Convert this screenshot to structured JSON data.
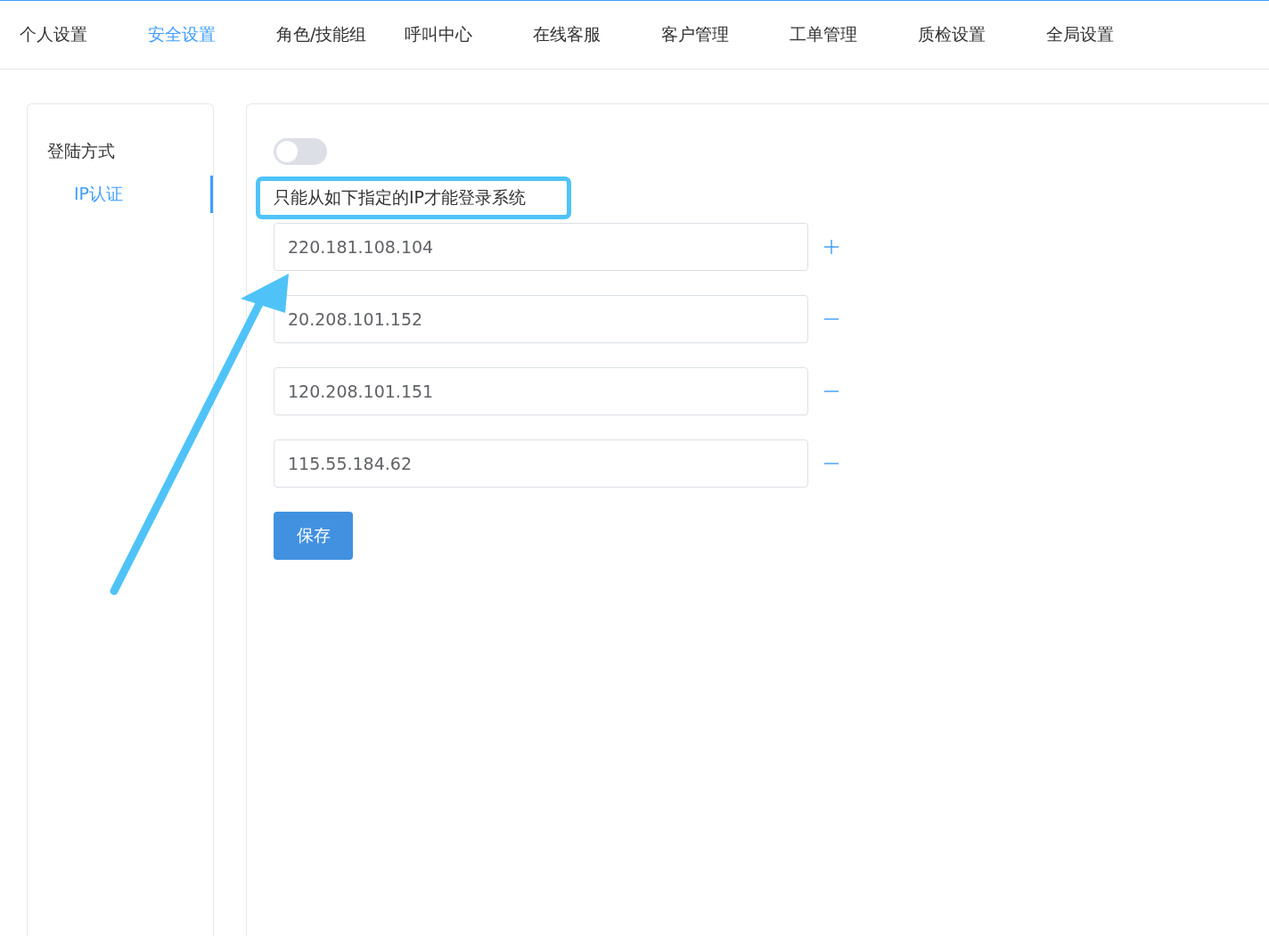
{
  "tabs": [
    {
      "label": "个人设置",
      "selected": false
    },
    {
      "label": "安全设置",
      "selected": true
    },
    {
      "label": "角色/技能组",
      "selected": false
    },
    {
      "label": "呼叫中心",
      "selected": false
    },
    {
      "label": "在线客服",
      "selected": false
    },
    {
      "label": "客户管理",
      "selected": false
    },
    {
      "label": "工单管理",
      "selected": false
    },
    {
      "label": "质检设置",
      "selected": false
    },
    {
      "label": "全局设置",
      "selected": false
    }
  ],
  "sidebar": {
    "heading": "登陆方式",
    "items": [
      {
        "label": "IP认证",
        "selected": true
      }
    ]
  },
  "ip_auth": {
    "toggle": {
      "on": false
    },
    "description": "只能从如下指定的IP才能登录系统",
    "ips": [
      {
        "value": "220.181.108.104",
        "kind": "add"
      },
      {
        "value": "20.208.101.152",
        "kind": "remove"
      },
      {
        "value": "120.208.101.151",
        "kind": "remove"
      },
      {
        "value": "115.55.184.62",
        "kind": "remove"
      }
    ],
    "save_button": "保存"
  }
}
